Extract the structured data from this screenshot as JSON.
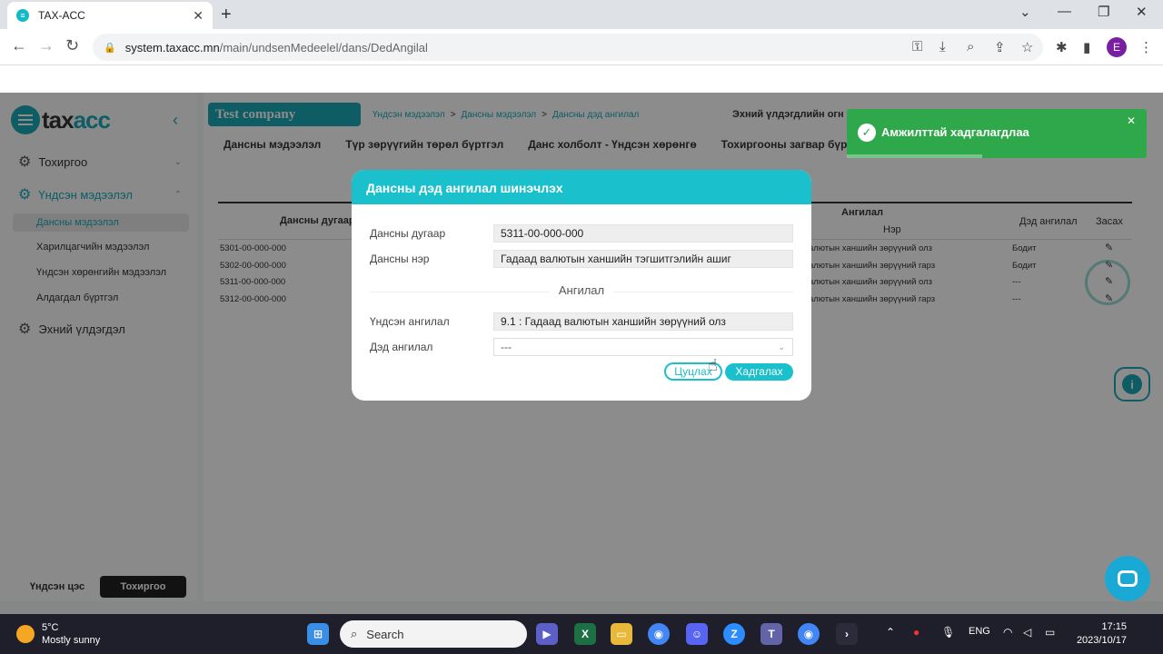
{
  "browser": {
    "tab_title": "TAX-ACC",
    "url_host": "system.taxacc.mn",
    "url_path": "/main/undsenMedeelel/dans/DedAngilal",
    "profile_initial": "E"
  },
  "logo": {
    "prefix": "tax",
    "suffix": "acc"
  },
  "sidebar": {
    "settings": "Тохиргоо",
    "basic_info": "Үндсэн мэдээлэл",
    "sub_items": [
      "Дансны мэдээлэл",
      "Харилцагчийн мэдээлэл",
      "Үндсэн хөрөнгийн мэдээлэл",
      "Алдагдал бүртгэл"
    ],
    "opening": "Эхний үлдэгдэл",
    "bottom_main": "Үндсэн цэс",
    "bottom_settings": "Тохиргоо"
  },
  "header": {
    "company": "Test company",
    "breadcrumb": [
      "Үндсэн мэдээлэл",
      "Дансны мэдээлэл",
      "Дансны дэд ангилал"
    ],
    "opening_label": "Эхний үлдэгдлийн огн"
  },
  "tabs": [
    "Дансны мэдээлэл",
    "Түр зөрүүгийн төрөл бүртгэл",
    "Данс холболт - Үндсэн хөрөнгө",
    "Тохиргооны загвар бүрт"
  ],
  "table": {
    "col_account": "Дансны дугаар",
    "col_category": "Ангилал",
    "col_name": "Нэр",
    "col_subcat": "Дэд ангилал",
    "col_edit": "Засах",
    "rows": [
      {
        "account": "5301-00-000-000",
        "name": "алютын ханшийн зөрүүний олз",
        "sub": "Бодит"
      },
      {
        "account": "5302-00-000-000",
        "name": "алютын ханшийн зөрүүний гарз",
        "sub": "Бодит"
      },
      {
        "account": "5311-00-000-000",
        "name": "алютын ханшийн зөрүүний олз",
        "sub": "---"
      },
      {
        "account": "5312-00-000-000",
        "name": "алютын ханшийн зөрүүний гарз",
        "sub": "---"
      }
    ]
  },
  "modal": {
    "title": "Дансны дэд ангилал шинэчлэх",
    "account_label": "Дансны дугаар",
    "account_value": "5311-00-000-000",
    "name_label": "Дансны нэр",
    "name_value": "Гадаад валютын ханшийн тэгшитгэлийн ашиг",
    "section": "Ангилал",
    "main_cat_label": "Үндсэн ангилал",
    "main_cat_value": "9.1 : Гадаад валютын ханшийн зөрүүний олз",
    "sub_cat_label": "Дэд ангилал",
    "sub_cat_value": "---",
    "cancel": "Цуцлах",
    "save": "Хадгалах"
  },
  "toast": {
    "message": "Амжилттай хадгалагдлаа",
    "progress": 0.45
  },
  "taskbar": {
    "temp": "5°C",
    "weather": "Mostly sunny",
    "search": "Search",
    "lang": "ENG",
    "time": "17:15",
    "date": "2023/10/17"
  }
}
